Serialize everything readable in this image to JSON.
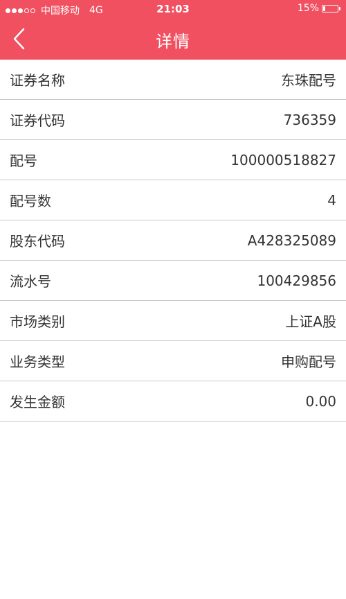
{
  "status": {
    "carrier": "中国移动",
    "network": "4G",
    "time": "21:03",
    "battery": "15%",
    "battery_level": 0.15
  },
  "nav": {
    "title": "详情",
    "back_icon": "chevron-left-icon"
  },
  "colors": {
    "header": "#f05060",
    "text": "#333333",
    "divider": "#c8c8c8"
  },
  "details": [
    {
      "label": "证券名称",
      "value": "东珠配号"
    },
    {
      "label": "证券代码",
      "value": "736359"
    },
    {
      "label": "配号",
      "value": "100000518827"
    },
    {
      "label": "配号数",
      "value": "4"
    },
    {
      "label": "股东代码",
      "value": "A428325089"
    },
    {
      "label": "流水号",
      "value": "100429856"
    },
    {
      "label": "市场类别",
      "value": "上证A股"
    },
    {
      "label": "业务类型",
      "value": "申购配号"
    },
    {
      "label": "发生金额",
      "value": "0.00"
    }
  ]
}
